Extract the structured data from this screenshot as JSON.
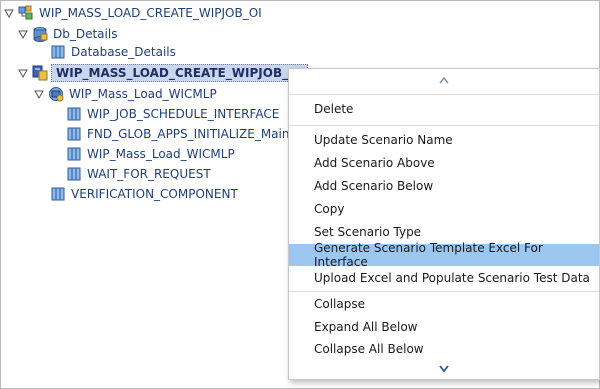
{
  "tree": {
    "root": {
      "label": "WIP_MASS_LOAD_CREATE_WIPJOB_OI"
    },
    "db_details": {
      "label": "Db_Details"
    },
    "database_details": {
      "label": "Database_Details"
    },
    "scenario": {
      "label": "WIP_MASS_LOAD_CREATE_WIPJOB_OI"
    },
    "wicmlp_group": {
      "label": "WIP_Mass_Load_WICMLP"
    },
    "children": [
      {
        "label": "WIP_JOB_SCHEDULE_INTERFACE"
      },
      {
        "label": "FND_GLOB_APPS_INITIALIZE_Main"
      },
      {
        "label": "WIP_Mass_Load_WICMLP"
      },
      {
        "label": "WAIT_FOR_REQUEST"
      }
    ],
    "verification": {
      "label": "VERIFICATION_COMPONENT"
    }
  },
  "context_menu": {
    "items": [
      {
        "label": "Delete"
      },
      {
        "label": "Update Scenario Name"
      },
      {
        "label": "Add Scenario Above"
      },
      {
        "label": "Add Scenario Below"
      },
      {
        "label": "Copy"
      },
      {
        "label": "Set Scenario Type"
      },
      {
        "label": "Generate Scenario Template Excel For Interface",
        "highlighted": true
      },
      {
        "label": "Upload Excel and Populate Scenario Test Data"
      },
      {
        "label": "Collapse"
      },
      {
        "label": "Expand All Below"
      },
      {
        "label": "Collapse All Below"
      }
    ],
    "scroll_up_icon": "chevron-up-icon",
    "scroll_down_icon": "chevron-down-icon"
  },
  "colors": {
    "selection_bg": "#c9d6ee",
    "menu_highlight": "#9cc7f0",
    "tree_text": "#1f3f7a"
  }
}
